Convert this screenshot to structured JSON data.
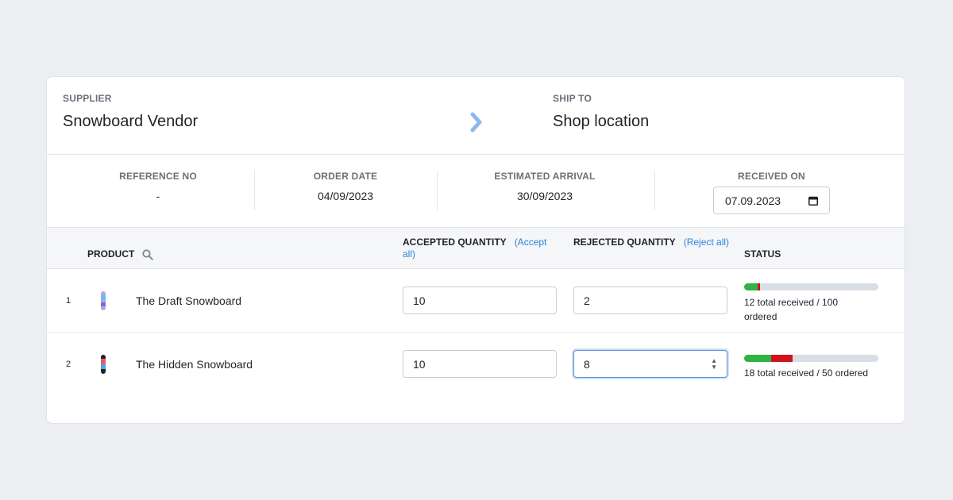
{
  "supplier": {
    "label": "SUPPLIER",
    "value": "Snowboard Vendor"
  },
  "ship_to": {
    "label": "SHIP TO",
    "value": "Shop location"
  },
  "meta": {
    "reference_no": {
      "label": "REFERENCE NO",
      "value": "-"
    },
    "order_date": {
      "label": "ORDER DATE",
      "value": "04/09/2023"
    },
    "estimated_arrival": {
      "label": "ESTIMATED ARRIVAL",
      "value": "30/09/2023"
    },
    "received_on": {
      "label": "RECEIVED ON",
      "value": "07.09.2023"
    }
  },
  "table": {
    "headers": {
      "product": "PRODUCT",
      "accepted": "ACCEPTED QUANTITY",
      "accept_all": "(Accept all)",
      "rejected": "REJECTED QUANTITY",
      "reject_all": "(Reject all)",
      "status": "STATUS"
    },
    "rows": [
      {
        "index": "1",
        "product": "The Draft Snowboard",
        "accepted": "10",
        "rejected": "2",
        "accepted_fraction": 0.1,
        "rejected_fraction": 0.02,
        "status_text": "12 total received / 100 ordered"
      },
      {
        "index": "2",
        "product": "The Hidden Snowboard",
        "accepted": "10",
        "rejected": "8",
        "accepted_fraction": 0.2,
        "rejected_fraction": 0.16,
        "status_text": "18 total received / 50 ordered"
      }
    ]
  },
  "colors": {
    "accepted": "#2fb344",
    "rejected": "#d0121b",
    "track": "#d9dde5",
    "link": "#2a84d8"
  },
  "icons": {
    "arrow": "chevron-right-icon",
    "search": "search-icon",
    "calendar": "calendar-icon"
  }
}
